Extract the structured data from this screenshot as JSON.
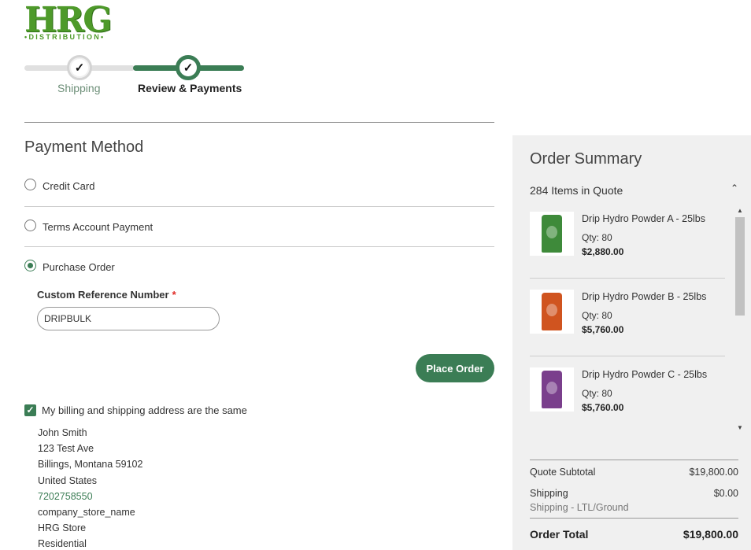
{
  "logo": {
    "main": "HRG",
    "sub": "•DISTRIBUTION•"
  },
  "progress": {
    "steps": [
      {
        "label": "Shipping",
        "check": "✓"
      },
      {
        "label": "Review & Payments",
        "check": "✓"
      }
    ]
  },
  "payment": {
    "title": "Payment Method",
    "options": [
      "Credit Card",
      "Terms Account Payment",
      "Purchase Order"
    ],
    "selected": "Purchase Order",
    "ref_label": "Custom Reference Number",
    "required_mark": "*",
    "ref_value": "DRIPBULK",
    "place_order": "Place Order"
  },
  "billing": {
    "same_label": "My billing and shipping address are the same",
    "check": "✓",
    "address": [
      "John Smith",
      "123 Test Ave",
      "Billings, Montana 59102",
      "United States",
      "7202758550",
      "company_store_name",
      "HRG Store",
      "Residential"
    ]
  },
  "summary": {
    "title": "Order Summary",
    "items_count": "284 Items in Quote",
    "collapse_icon": "⌃",
    "items": [
      {
        "name": "Drip Hydro Powder A - 25lbs",
        "qty": "Qty: 80",
        "price": "$2,880.00",
        "color": "#3e8a3a"
      },
      {
        "name": "Drip Hydro Powder B - 25lbs",
        "qty": "Qty: 80",
        "price": "$5,760.00",
        "color": "#d0541f"
      },
      {
        "name": "Drip Hydro Powder C - 25lbs",
        "qty": "Qty: 80",
        "price": "$5,760.00",
        "color": "#7a3f8c"
      }
    ],
    "scroll_up": "▲",
    "scroll_down": "▼",
    "subtotal_label": "Quote Subtotal",
    "subtotal_value": "$19,800.00",
    "shipping_label": "Shipping",
    "shipping_value": "$0.00",
    "shipping_method": "Shipping - LTL/Ground",
    "total_label": "Order Total",
    "total_value": "$19,800.00"
  }
}
